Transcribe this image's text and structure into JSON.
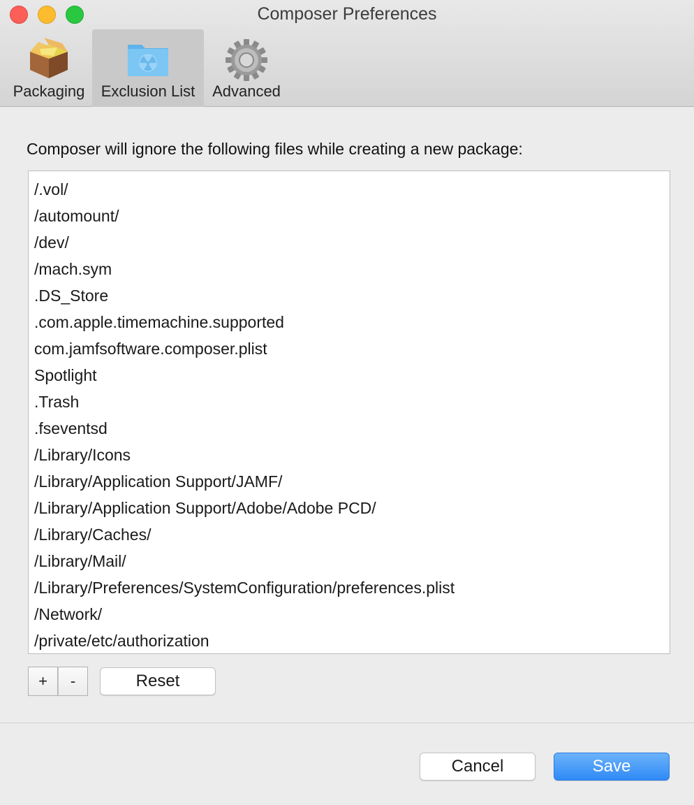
{
  "window": {
    "title": "Composer Preferences"
  },
  "toolbar": {
    "tabs": [
      {
        "label": "Packaging",
        "icon": "package-box-icon",
        "selected": false
      },
      {
        "label": "Exclusion List",
        "icon": "folder-radiation-icon",
        "selected": true
      },
      {
        "label": "Advanced",
        "icon": "gear-icon",
        "selected": false
      }
    ]
  },
  "main": {
    "description": "Composer will ignore the following files while creating a new package:",
    "exclusion_list": [
      "/.vol/",
      "/automount/",
      "/dev/",
      "/mach.sym",
      ".DS_Store",
      ".com.apple.timemachine.supported",
      "com.jamfsoftware.composer.plist",
      "Spotlight",
      ".Trash",
      ".fseventsd",
      "/Library/Icons",
      "/Library/Application Support/JAMF/",
      "/Library/Application Support/Adobe/Adobe PCD/",
      "/Library/Caches/",
      "/Library/Mail/",
      "/Library/Preferences/SystemConfiguration/preferences.plist",
      "/Network/",
      "/private/etc/authorization"
    ],
    "add_label": "+",
    "remove_label": "-",
    "reset_label": "Reset"
  },
  "footer": {
    "cancel_label": "Cancel",
    "save_label": "Save"
  },
  "colors": {
    "accent": "#2f8af6",
    "close": "#fc5f57",
    "minimize": "#fdbc2e",
    "zoom": "#29c840"
  }
}
